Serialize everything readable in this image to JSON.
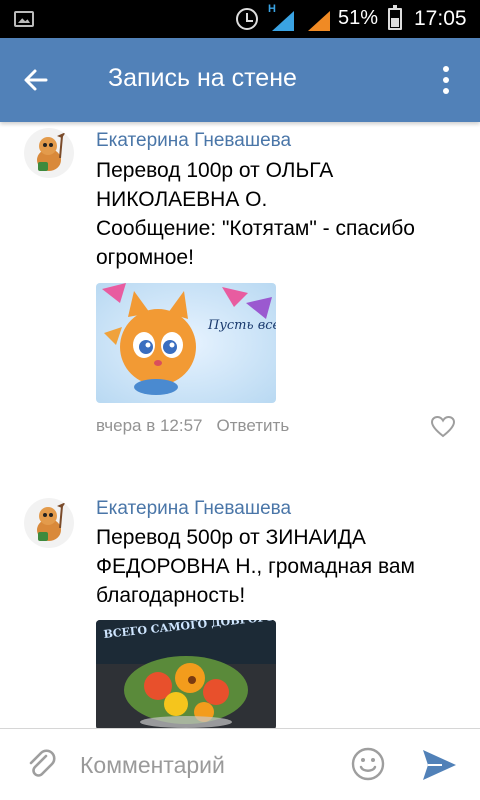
{
  "status_bar": {
    "battery_percent": "51%",
    "time": "17:05",
    "network_type": "H"
  },
  "header": {
    "title": "Запись на стене",
    "back_icon": "arrow-left-icon",
    "more_icon": "more-vertical-icon"
  },
  "comments": [
    {
      "author": "Екатерина Гневашева",
      "text": "Перевод 100р от ОЛЬГА\nНИКОЛАЕВНА О.\nСообщение: \"Котятам\" - спасибо\nогромное!",
      "image_text": "Пусть всегда хочется мурлыкать",
      "time": "вчера в 12:57",
      "reply_label": "Ответить"
    },
    {
      "author": "Екатерина Гневашева",
      "text": "Перевод 500р от ЗИНАИДА\nФЕДОРОВНА Н., громадная вам\nблагодарность!",
      "image_text": "ВСЕГО САМОГО ДОБРОГО!"
    }
  ],
  "comment_bar": {
    "placeholder": "Комментарий",
    "attach_icon": "paperclip-icon",
    "emoji_icon": "emoji-icon",
    "send_icon": "send-icon"
  },
  "colors": {
    "header_bg": "#5181b8",
    "author": "#4a76a8",
    "meta": "#939393",
    "send": "#5181b8"
  }
}
